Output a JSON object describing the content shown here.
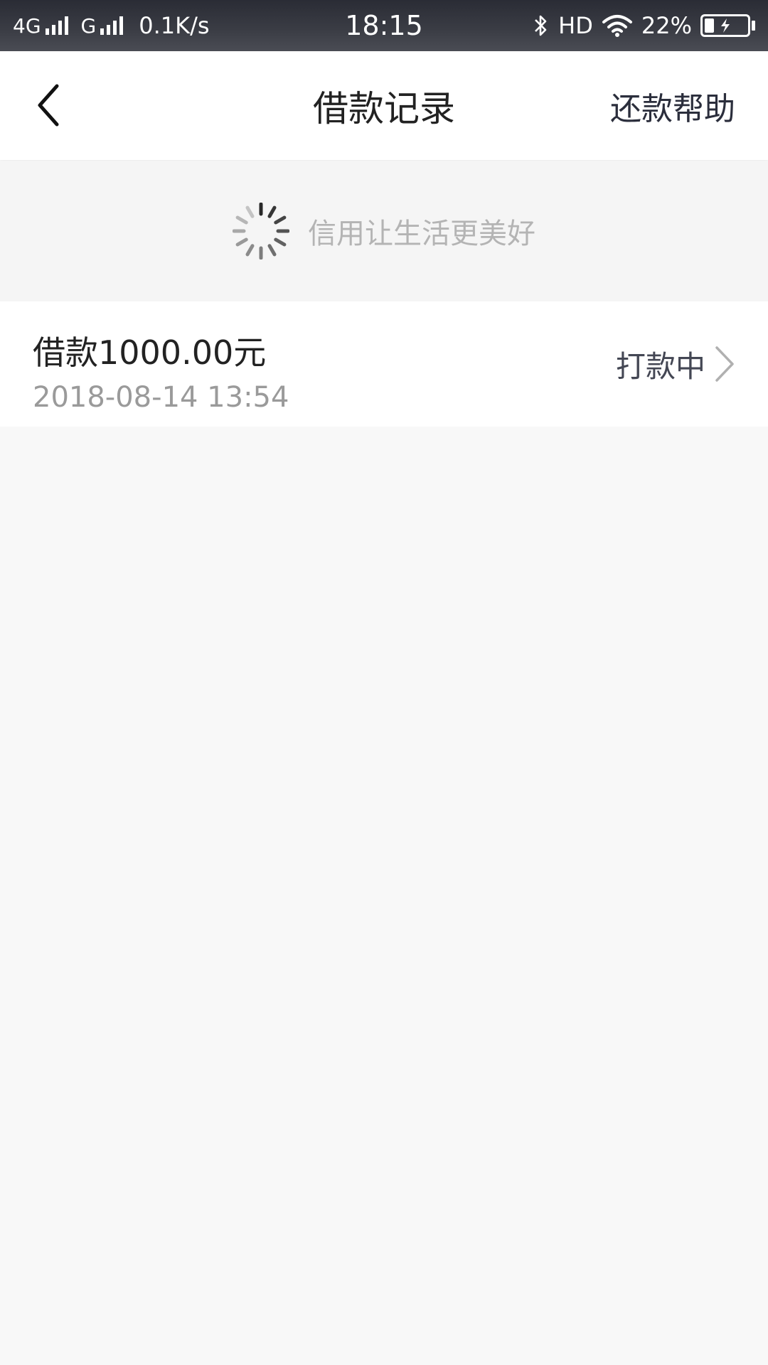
{
  "status_bar": {
    "network_1": "4G",
    "network_2": "G",
    "speed": "0.1K/s",
    "time": "18:15",
    "hd": "HD",
    "battery_percent": "22%",
    "battery_level": 0.22,
    "charging": true
  },
  "nav": {
    "title": "借款记录",
    "help_label": "还款帮助"
  },
  "loading": {
    "text": "信用让生活更美好"
  },
  "records": [
    {
      "amount": "借款1000.00元",
      "date": "2018-08-14 13:54",
      "status": "打款中"
    }
  ],
  "colors": {
    "status_bar_bg": "#33353e",
    "page_bg": "#f8f8f8",
    "title_text": "#222222",
    "secondary_text": "#9a9a9a",
    "placeholder_text": "#b4b4b4"
  }
}
